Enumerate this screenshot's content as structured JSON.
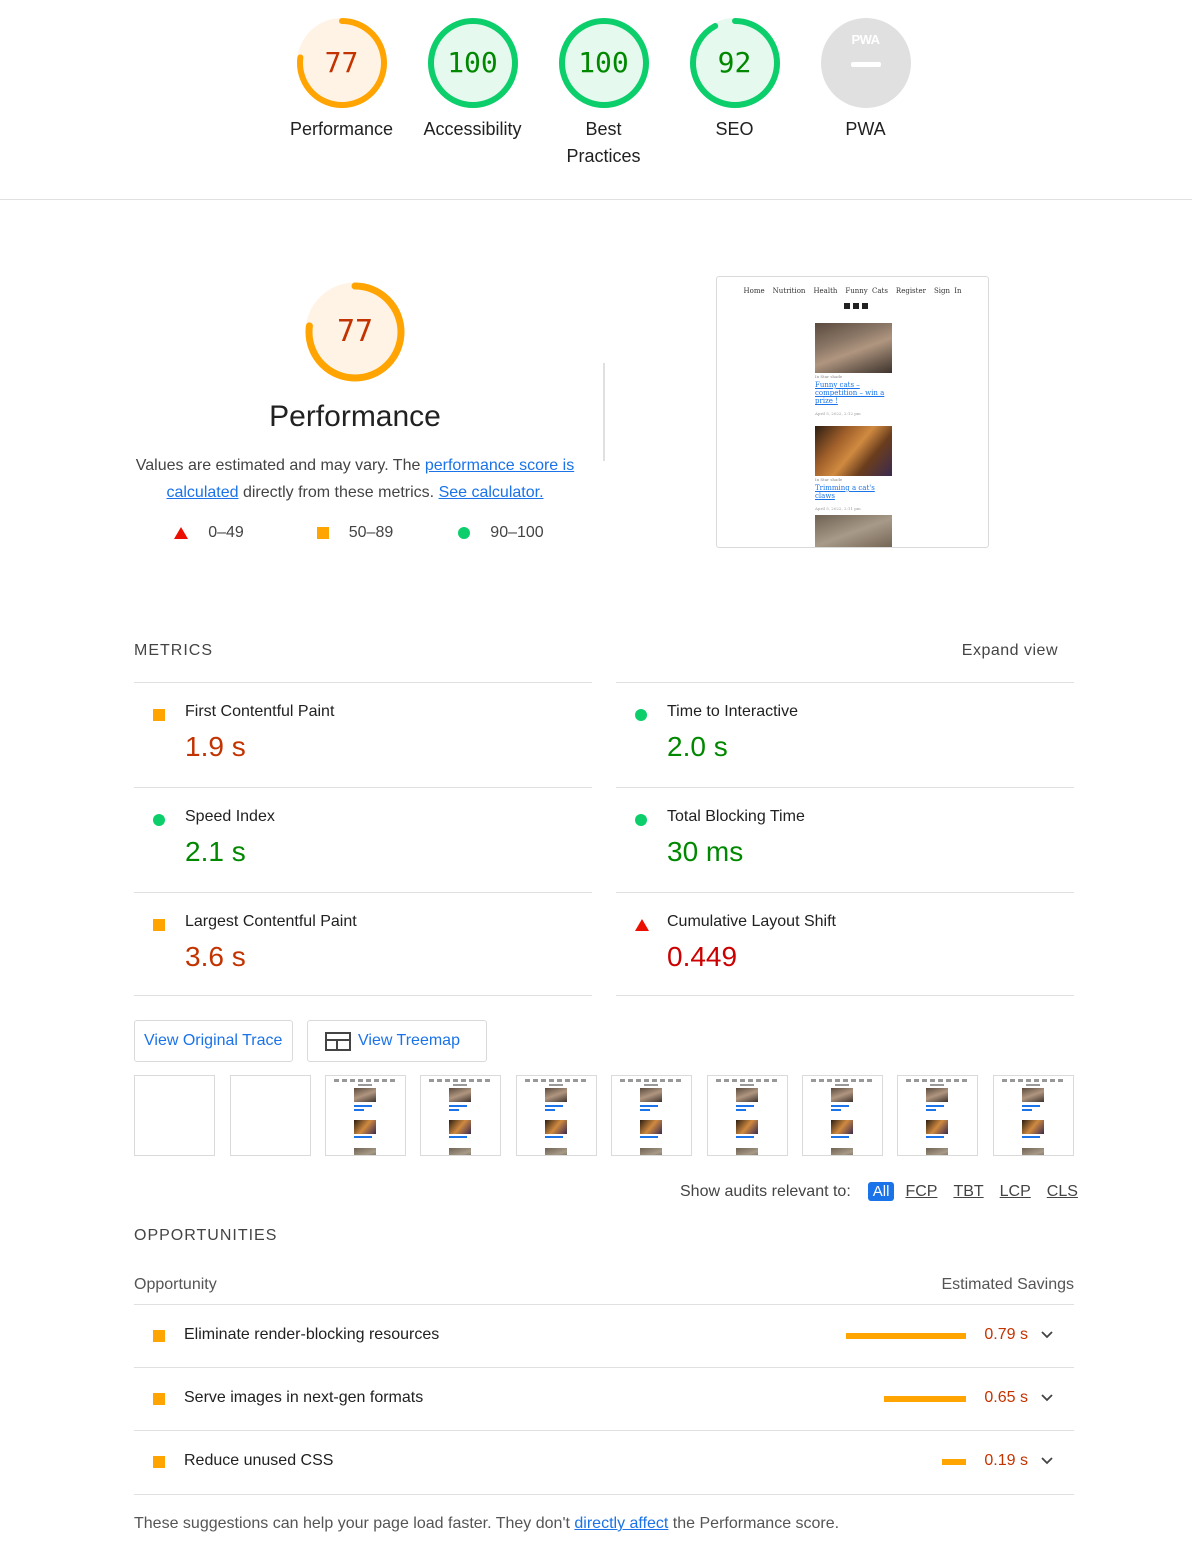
{
  "colors": {
    "fail": "#eb0f00",
    "average": "#ffa400",
    "pass": "#0cce6b",
    "average_text": "#c33300",
    "pass_text": "#008800",
    "fail_text": "#cc0000",
    "link": "#1a73e8"
  },
  "categories": [
    {
      "label": "Performance",
      "score": "77",
      "value": 77,
      "rating": "average"
    },
    {
      "label": "Accessibility",
      "score": "100",
      "value": 100,
      "rating": "pass"
    },
    {
      "label": "Best Practices",
      "score": "100",
      "value": 100,
      "rating": "pass"
    },
    {
      "label": "SEO",
      "score": "92",
      "value": 92,
      "rating": "pass"
    },
    {
      "label": "PWA",
      "score": "PWA",
      "value": null,
      "rating": "na"
    }
  ],
  "performance": {
    "score": "77",
    "value": 77,
    "title": "Performance",
    "desc_prefix": "Values are estimated and may vary. The ",
    "desc_link1": "performance score is calculated",
    "desc_middle": " directly from these metrics. ",
    "desc_link2": "See calculator.",
    "legend": {
      "fail": "0–49",
      "average": "50–89",
      "pass": "90–100"
    }
  },
  "screenshot": {
    "nav": [
      "Home",
      "Nutrition",
      "Health",
      "Funny Cats",
      "Register",
      "Sign In"
    ],
    "posts": [
      {
        "meta": "In Star shade",
        "title": "Funny cats – competition – win a prize !",
        "date": "April 5, 2022, 2:12 pm"
      },
      {
        "meta": "In Star shade",
        "title": "Trimming a cat's claws",
        "date": "April 5, 2022, 2:11 pm"
      }
    ]
  },
  "metrics": {
    "heading": "METRICS",
    "expand_label": "Expand view",
    "items": [
      {
        "name": "First Contentful Paint",
        "value": "1.9 s",
        "rating": "average"
      },
      {
        "name": "Time to Interactive",
        "value": "2.0 s",
        "rating": "pass"
      },
      {
        "name": "Speed Index",
        "value": "2.1 s",
        "rating": "pass"
      },
      {
        "name": "Total Blocking Time",
        "value": "30 ms",
        "rating": "pass"
      },
      {
        "name": "Largest Contentful Paint",
        "value": "3.6 s",
        "rating": "average"
      },
      {
        "name": "Cumulative Layout Shift",
        "value": "0.449",
        "rating": "fail"
      }
    ]
  },
  "buttons": {
    "trace": "View Original Trace",
    "treemap": "View Treemap"
  },
  "filter": {
    "label": "Show audits relevant to:",
    "options": [
      "All",
      "FCP",
      "TBT",
      "LCP",
      "CLS"
    ],
    "selected": "All"
  },
  "opportunities": {
    "heading": "OPPORTUNITIES",
    "col_left": "Opportunity",
    "col_right": "Estimated Savings",
    "items": [
      {
        "name": "Eliminate render-blocking resources",
        "saving": "0.79 s",
        "seconds": 0.79
      },
      {
        "name": "Serve images in next-gen formats",
        "saving": "0.65 s",
        "seconds": 0.65
      },
      {
        "name": "Reduce unused CSS",
        "saving": "0.19 s",
        "seconds": 0.19
      }
    ],
    "note_prefix": "These suggestions can help your page load faster. They don't ",
    "note_link": "directly affect",
    "note_suffix": " the Performance score."
  }
}
